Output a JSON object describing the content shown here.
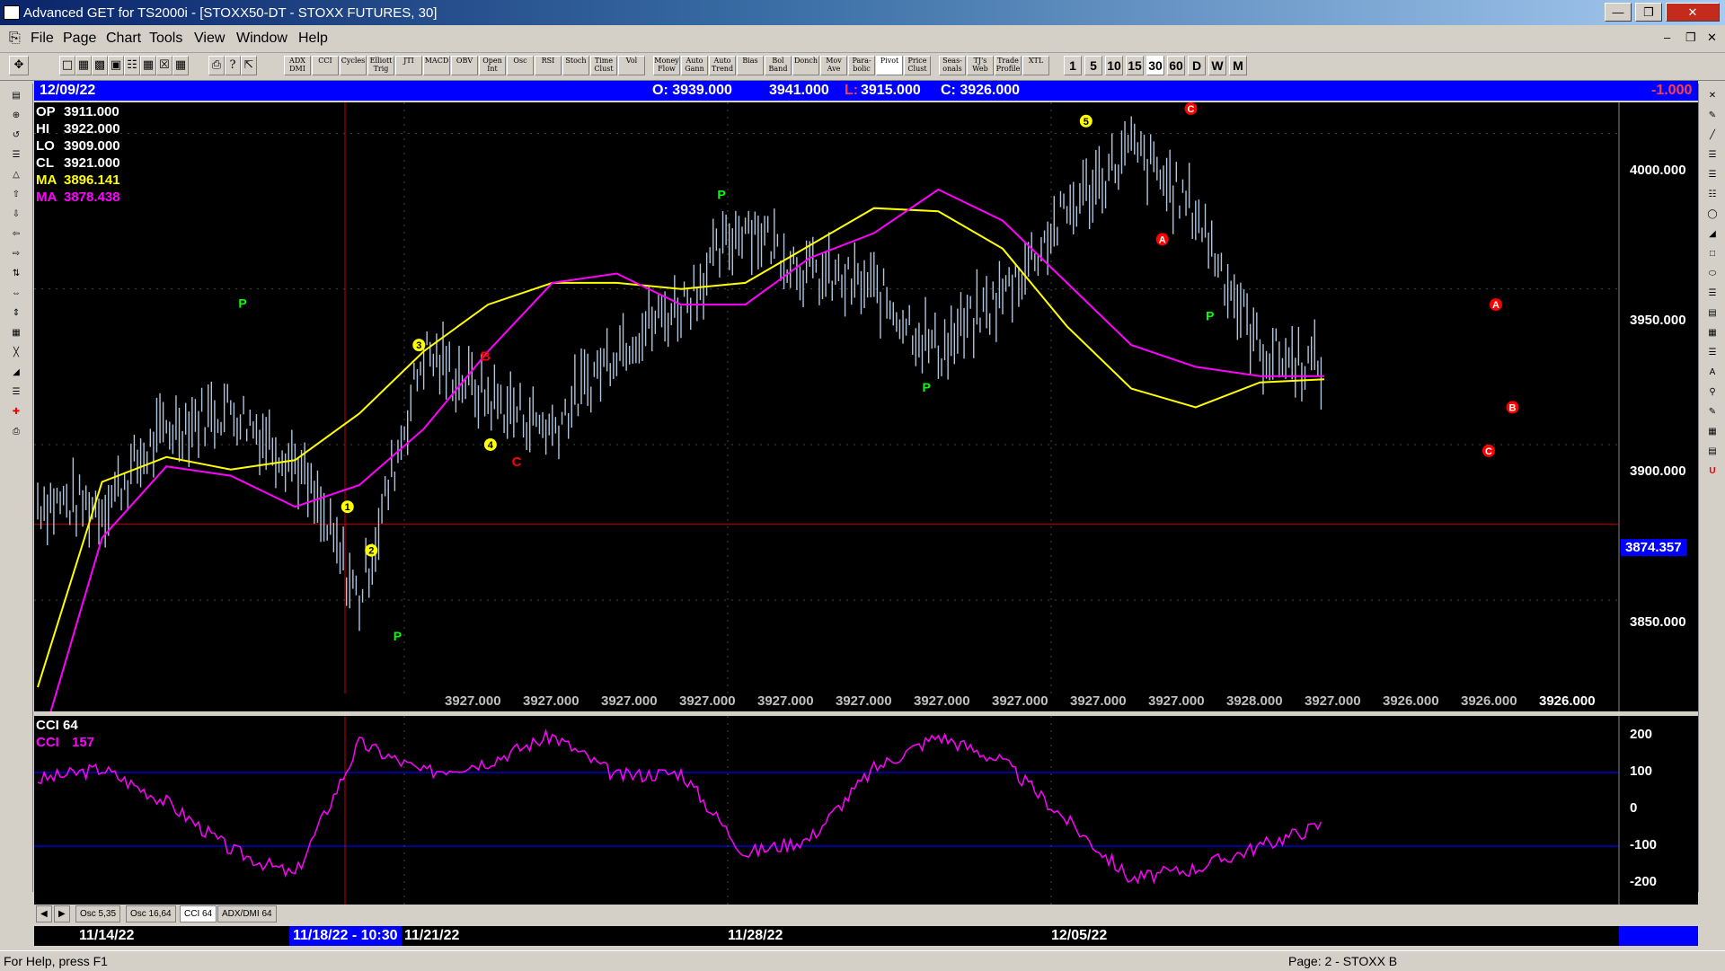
{
  "window": {
    "title": "Advanced GET for TS2000i - [STOXX50-DT - STOXX FUTURES, 30]"
  },
  "menu": [
    "File",
    "Page",
    "Chart",
    "Tools",
    "View",
    "Window",
    "Help"
  ],
  "toolbar": {
    "indicators": [
      "ADX DMI",
      "CCI",
      "Cycles",
      "Elliott Trig",
      "JTI",
      "MACD",
      "OBV",
      "Open Int",
      "Osc",
      "RSI",
      "Stoch",
      "Time Clust",
      "Vol",
      "Money Flow",
      "Auto Gann",
      "Auto Trend",
      "Bias",
      "Bol Band",
      "Donch",
      "Mov Ave",
      "Para-bolic",
      "Pivot",
      "Price Clust",
      "Seas-onals",
      "TJ's Web",
      "Trade Profile",
      "XTL"
    ],
    "intervals": [
      "1",
      "5",
      "10",
      "15",
      "30",
      "60",
      "D",
      "W",
      "M"
    ],
    "active_interval": "30"
  },
  "infobar": {
    "date": "12/09/22",
    "open": "O: 3939.000",
    "high": "3941.000",
    "low_label": "L:",
    "low": "3915.000",
    "close": "C: 3926.000",
    "change": "-1.000"
  },
  "legend": {
    "op_label": "OP",
    "op": "3911.000",
    "hi_label": "HI",
    "hi": "3922.000",
    "lo_label": "LO",
    "lo": "3909.000",
    "cl_label": "CL",
    "cl": "3921.000",
    "ma1_label": "MA",
    "ma1": "3896.141",
    "ma2_label": "MA",
    "ma2": "3878.438"
  },
  "price_axis": [
    "4000.000",
    "3950.000",
    "3900.000",
    "3850.000"
  ],
  "cursor_price": "3874.357",
  "bottom_values": [
    "3927.000",
    "3927.000",
    "3927.000",
    "3927.000",
    "3927.000",
    "3927.000",
    "3927.000",
    "3927.000",
    "3927.000",
    "3927.000",
    "3928.000",
    "3927.000",
    "3926.000",
    "3926.000",
    "3926.000"
  ],
  "elliott_labels": {
    "waves": [
      "1",
      "2",
      "3",
      "4",
      "5"
    ],
    "abc": [
      "A",
      "B",
      "C"
    ],
    "pivot": "P"
  },
  "cci_panel": {
    "title": "CCI 64",
    "label": "CCI",
    "value": "157",
    "axis": [
      "200",
      "100",
      "0",
      "-100",
      "-200"
    ]
  },
  "tabs": [
    "Osc 5,35",
    "Osc 16,64",
    "CCI 64",
    "ADX/DMI 64"
  ],
  "dates": {
    "d1": "11/14/22",
    "cursor": "11/18/22 - 10:30",
    "d2": "11/21/22",
    "d3": "11/28/22",
    "d4": "12/05/22"
  },
  "status": {
    "help": "For Help, press F1",
    "page": "Page: 2 - STOXX B"
  },
  "colors": {
    "ma_yellow": "#ffff00",
    "ma_magenta": "#ff00ff",
    "bars": "#b0c4de",
    "cursor": "#cc0000",
    "pivot": "#00ff00",
    "wave": "#ffff00",
    "abc": "#ff0000"
  },
  "chart_data": {
    "type": "line",
    "title": "STOXX50-DT - STOXX FUTURES, 30",
    "xlabel": "",
    "ylabel": "",
    "ylim": [
      3820,
      4010
    ],
    "x": [
      0,
      10,
      20,
      30,
      40,
      50,
      60,
      70,
      80,
      90,
      100,
      110,
      120,
      130,
      140,
      150,
      160,
      170,
      180,
      190,
      200
    ],
    "series": [
      {
        "name": "Price",
        "values": [
          3882,
          3880,
          3905,
          3912,
          3895,
          3850,
          3930,
          3915,
          3905,
          3932,
          3945,
          3972,
          3955,
          3950,
          3930,
          3948,
          3975,
          3995,
          3975,
          3930,
          3925
        ]
      },
      {
        "name": "MA",
        "values": [
          3822,
          3888,
          3896,
          3892,
          3895,
          3910,
          3930,
          3945,
          3952,
          3952,
          3950,
          3952,
          3964,
          3976,
          3975,
          3963,
          3938,
          3918,
          3912,
          3920,
          3921
        ]
      },
      {
        "name": "MA",
        "values": [
          3800,
          3870,
          3893,
          3890,
          3880,
          3887,
          3905,
          3930,
          3952,
          3955,
          3945,
          3945,
          3960,
          3968,
          3982,
          3972,
          3952,
          3932,
          3925,
          3922,
          3922
        ]
      }
    ],
    "cci": [
      80,
      110,
      20,
      -110,
      -180,
      180,
      100,
      130,
      200,
      90,
      100,
      -120,
      -80,
      110,
      200,
      130,
      -30,
      -190,
      -160,
      -100,
      -40
    ]
  }
}
